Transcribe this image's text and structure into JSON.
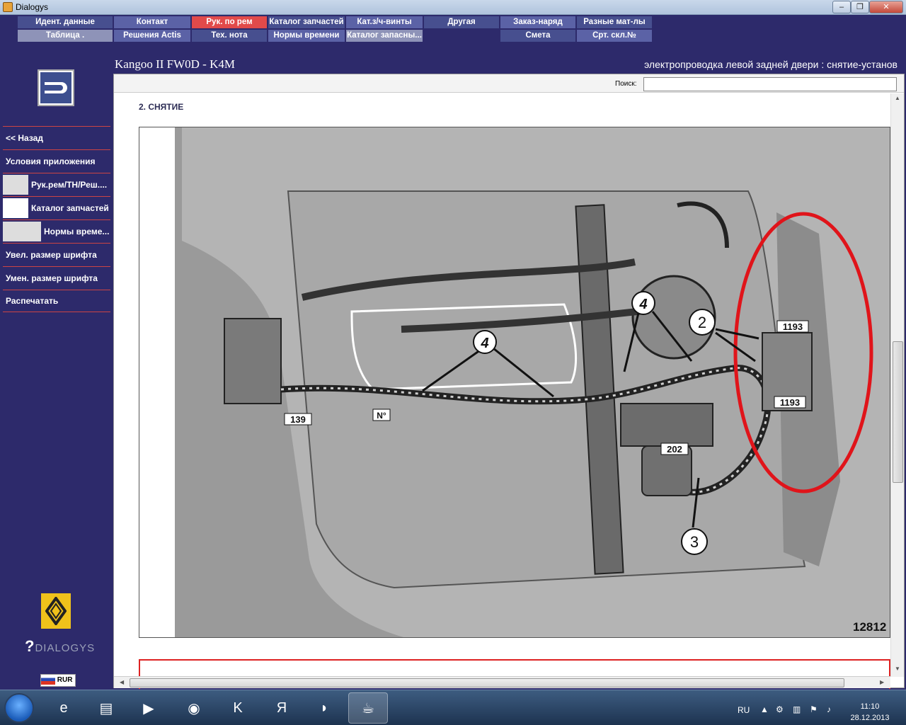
{
  "window": {
    "title": "Dialogys"
  },
  "menu": {
    "row1": [
      "Идент. данные",
      "Контакт",
      "Рук. по рем",
      "Каталог запчастей",
      "Кат.з/ч-винты",
      "Другая",
      "Заказ-наряд",
      "Разные мат-лы"
    ],
    "row2": [
      "Таблица .",
      "Решения Actis",
      "Тех. нота",
      "Нормы времени",
      "Каталог запасны...",
      "Смета",
      "Срт. скл.№"
    ]
  },
  "sidebar": {
    "items": [
      "<< Назад",
      "Условия приложения",
      "Рук.рем/ТН/Реш....",
      "Каталог запчастей",
      "Нормы време...",
      "Увел. размер шрифта",
      "Умен. размер шрифта",
      "Распечатать"
    ],
    "brand": "DIALOGYS",
    "currency": "RUR"
  },
  "header": {
    "model": "Kangoo II FW0D - K4M",
    "document_title": "электропроводка левой задней двери : снятие-установ"
  },
  "search": {
    "label": "Поиск:",
    "value": ""
  },
  "section": {
    "title": "2. СНЯТИЕ"
  },
  "figure": {
    "callouts": [
      "4",
      "4",
      "2",
      "3"
    ],
    "labels": [
      "139",
      "N°",
      "202",
      "1193",
      "1193"
    ],
    "ref_number": "12812"
  },
  "taskbar": {
    "lang": "RU",
    "time": "11:10",
    "date": "28.12.2013"
  },
  "colors": {
    "accent": "#e14a4a",
    "menu": "#474f8f",
    "sidebar": "#2d2a6b",
    "renault": "#f0c21b"
  }
}
